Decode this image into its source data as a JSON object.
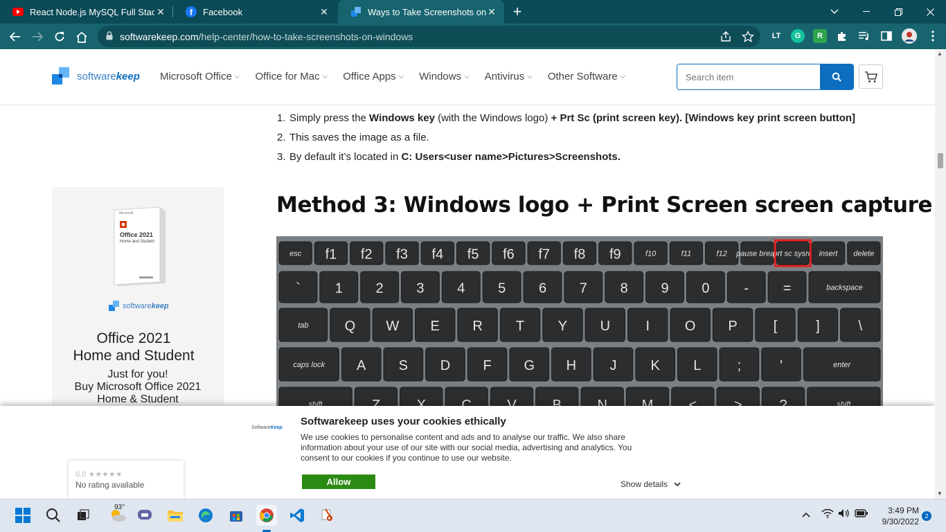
{
  "browser": {
    "tabs": [
      {
        "title": "React Node.js MySQL Full Stack E",
        "icon": "youtube-icon"
      },
      {
        "title": "Facebook",
        "icon": "facebook-icon"
      },
      {
        "title": "Ways to Take Screenshots on Wi",
        "icon": "softwarekeep-icon"
      }
    ],
    "url_host": "softwarekeep.com",
    "url_path": "/help-center/how-to-take-screenshots-on-windows",
    "extensions": [
      "LT",
      "G",
      "R"
    ]
  },
  "site": {
    "logo_prefix": "software",
    "logo_suffix": "keep",
    "nav": [
      {
        "label": "Microsoft Office"
      },
      {
        "label": "Office for Mac"
      },
      {
        "label": "Office Apps"
      },
      {
        "label": "Windows"
      },
      {
        "label": "Antivirus"
      },
      {
        "label": "Other Software"
      }
    ],
    "search_placeholder": "Search item"
  },
  "article": {
    "steps": [
      {
        "num": "1.",
        "parts": [
          {
            "t": "Simply press the ",
            "b": false
          },
          {
            "t": "Windows key",
            "b": true
          },
          {
            "t": " (with the Windows logo) ",
            "b": false
          },
          {
            "t": "+ Prt Sc (print screen key). [Windows key print screen button]",
            "b": true
          }
        ]
      },
      {
        "num": "2.",
        "parts": [
          {
            "t": "This saves the image as a file.",
            "b": false
          }
        ]
      },
      {
        "num": "3.",
        "parts": [
          {
            "t": "By default it’s located in ",
            "b": false
          },
          {
            "t": "C: Users<user name>Pictures>Screenshots.",
            "b": true
          }
        ]
      }
    ],
    "heading": "Method 3: Windows logo + Print Screen screen capture",
    "keyboard_rows": [
      [
        "esc",
        "f1",
        "f2",
        "f3",
        "f4",
        "f5",
        "f6",
        "f7",
        "f8",
        "f9",
        "f10",
        "f11",
        "f12",
        "pause break",
        "prt sc sysrq",
        "insert",
        "delete"
      ],
      [
        "`",
        "1",
        "2",
        "3",
        "4",
        "5",
        "6",
        "7",
        "8",
        "9",
        "0",
        "-",
        "=",
        "backspace"
      ],
      [
        "tab",
        "Q",
        "W",
        "E",
        "R",
        "T",
        "Y",
        "U",
        "I",
        "O",
        "P",
        "[",
        "]",
        "\\"
      ],
      [
        "caps lock",
        "A",
        "S",
        "D",
        "F",
        "G",
        "H",
        "J",
        "K",
        "L",
        ";",
        "'",
        "enter"
      ],
      [
        "shift",
        "Z",
        "X",
        "C",
        "V",
        "B",
        "N",
        "M",
        "<",
        ">",
        "?",
        "shift"
      ]
    ],
    "highlight_key": "prt sc sysrq"
  },
  "ad": {
    "box_brand": "Microsoft",
    "box_title": "Office 2021",
    "box_sub": "Home and Student",
    "logo_prefix": "software",
    "logo_suffix": "keep",
    "title_line1": "Office 2021",
    "title_line2": "Home and Student",
    "sub_line1": "Just for you!",
    "sub_line2": "Buy Microsoft Office 2021",
    "sub_line3": "Home & Student"
  },
  "cookie": {
    "logo_prefix": "Software",
    "logo_suffix": "Keep",
    "title": "Softwarekeep uses your cookies ethically",
    "text": "We use cookies to personalise content and ads and to analyse our traffic. We also share information about your use of our site with our social media, advertising and analytics. You consent to our cookies if you continue to use our website.",
    "allow": "Allow",
    "details": "Show details"
  },
  "rating": {
    "score": "0.0 ★★★★★",
    "label": "No rating available"
  },
  "taskbar": {
    "weather": "93°",
    "time": "3:49 PM",
    "date": "9/30/2022",
    "notifications": "2"
  },
  "colors": {
    "tabstrip": "#0b4a57",
    "toolbar": "#17646f",
    "brand": "#0d6ec0",
    "allow": "#2b8a14",
    "highlight": "#e02020"
  }
}
